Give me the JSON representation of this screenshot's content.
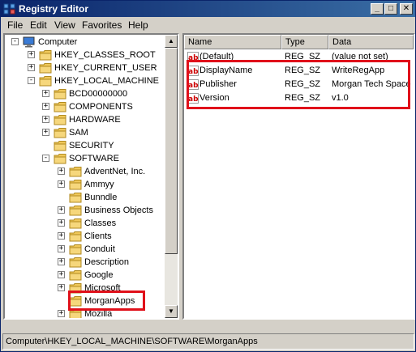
{
  "window": {
    "title": "Registry Editor",
    "minimize_label": "_",
    "maximize_label": "□",
    "close_label": "✕"
  },
  "menu": [
    "File",
    "Edit",
    "View",
    "Favorites",
    "Help"
  ],
  "tree": {
    "items": [
      {
        "label": "Computer",
        "expander": "-",
        "icon": "computer-icon"
      },
      {
        "label": "HKEY_CLASSES_ROOT",
        "expander": "+",
        "icon": "folder-icon"
      },
      {
        "label": "HKEY_CURRENT_USER",
        "expander": "+",
        "icon": "folder-icon"
      },
      {
        "label": "HKEY_LOCAL_MACHINE",
        "expander": "-",
        "icon": "folder-icon"
      },
      {
        "label": "BCD00000000",
        "expander": "+",
        "icon": "folder-icon"
      },
      {
        "label": "COMPONENTS",
        "expander": "+",
        "icon": "folder-icon"
      },
      {
        "label": "HARDWARE",
        "expander": "+",
        "icon": "folder-icon"
      },
      {
        "label": "SAM",
        "expander": "+",
        "icon": "folder-icon"
      },
      {
        "label": "SECURITY",
        "expander": "",
        "icon": "folder-icon"
      },
      {
        "label": "SOFTWARE",
        "expander": "-",
        "icon": "folder-icon"
      },
      {
        "label": "AdventNet, Inc.",
        "expander": "+",
        "icon": "folder-icon"
      },
      {
        "label": "Ammyy",
        "expander": "+",
        "icon": "folder-icon"
      },
      {
        "label": "Bunndle",
        "expander": "",
        "icon": "folder-icon"
      },
      {
        "label": "Business Objects",
        "expander": "+",
        "icon": "folder-icon"
      },
      {
        "label": "Classes",
        "expander": "+",
        "icon": "folder-icon"
      },
      {
        "label": "Clients",
        "expander": "+",
        "icon": "folder-icon"
      },
      {
        "label": "Conduit",
        "expander": "+",
        "icon": "folder-icon"
      },
      {
        "label": "Description",
        "expander": "+",
        "icon": "folder-icon"
      },
      {
        "label": "Google",
        "expander": "+",
        "icon": "folder-icon"
      },
      {
        "label": "Microsoft",
        "expander": "+",
        "icon": "folder-icon"
      },
      {
        "label": "MorganApps",
        "expander": "",
        "icon": "folder-icon"
      },
      {
        "label": "Mozilla",
        "expander": "+",
        "icon": "folder-icon"
      }
    ]
  },
  "list": {
    "headers": {
      "name": "Name",
      "type": "Type",
      "data": "Data"
    },
    "rows": [
      {
        "name": "(Default)",
        "type": "REG_SZ",
        "data": "(value not set)"
      },
      {
        "name": "DisplayName",
        "type": "REG_SZ",
        "data": "WriteRegApp"
      },
      {
        "name": "Publisher",
        "type": "REG_SZ",
        "data": "Morgan Tech Space"
      },
      {
        "name": "Version",
        "type": "REG_SZ",
        "data": "v1.0"
      }
    ]
  },
  "status": "Computer\\HKEY_LOCAL_MACHINE\\SOFTWARE\\MorganApps",
  "colors": {
    "title_start": "#0a246a",
    "title_end": "#3a6ea5",
    "highlight_box": "#e0101a",
    "folder": "#f0c85a"
  }
}
